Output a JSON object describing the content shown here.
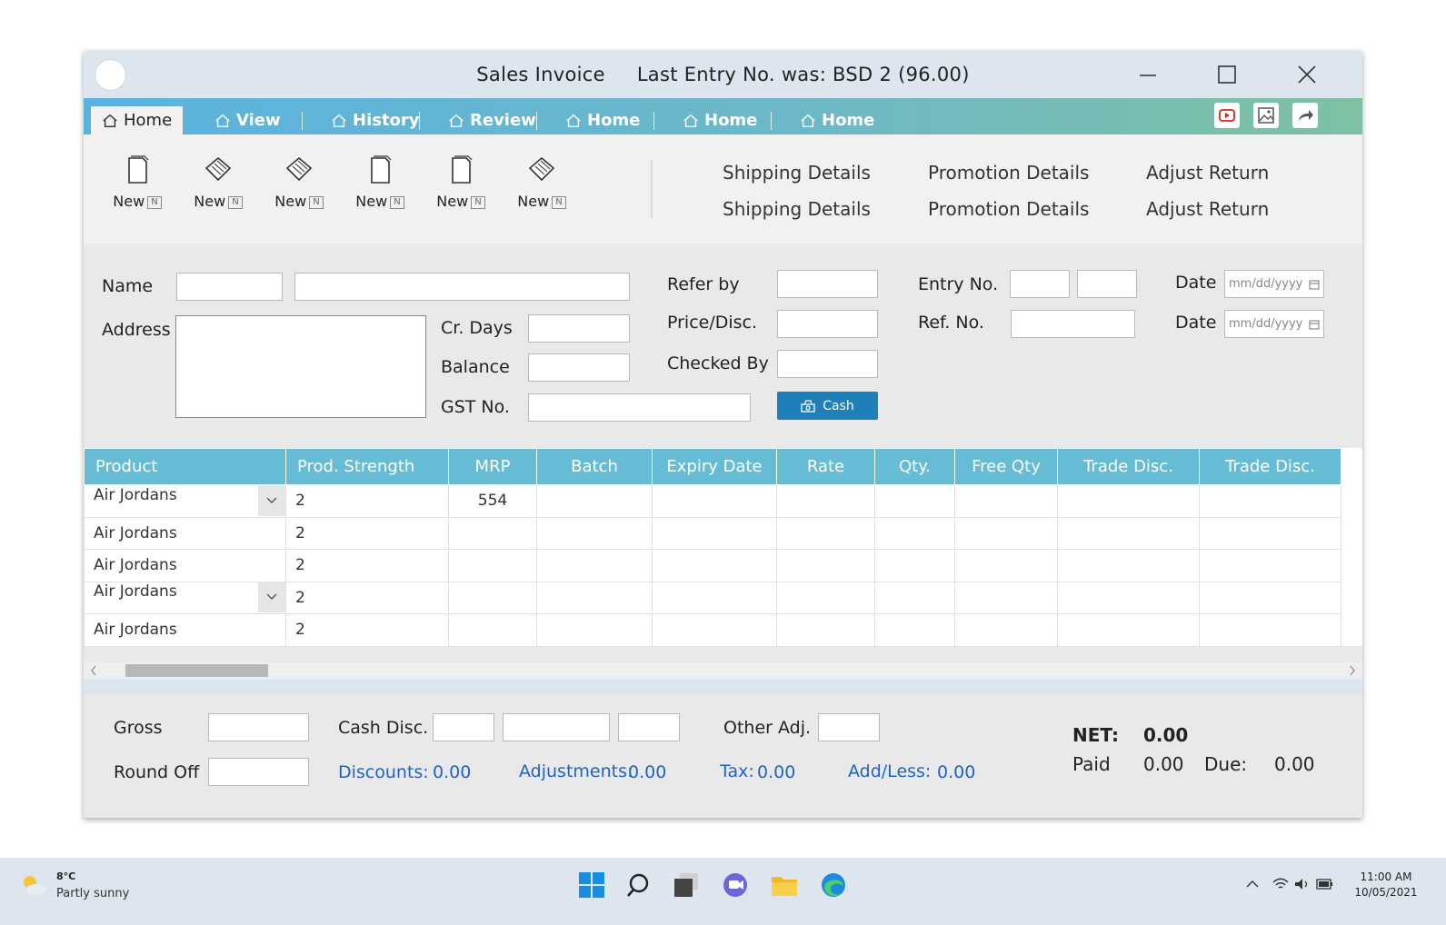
{
  "window": {
    "title": "Sales Invoice",
    "last_entry": "Last Entry No. was:  BSD 2 (96.00)"
  },
  "tabs": [
    {
      "label": "Home",
      "active": true
    },
    {
      "label": "View"
    },
    {
      "label": "History"
    },
    {
      "label": "Review"
    },
    {
      "label": "Home"
    },
    {
      "label": "Home"
    },
    {
      "label": "Home"
    }
  ],
  "toolbar": {
    "items": [
      {
        "label": "New",
        "key": "N",
        "icon": "document-icon"
      },
      {
        "label": "New",
        "key": "N",
        "icon": "cube-icon"
      },
      {
        "label": "New",
        "key": "N",
        "icon": "cube-icon"
      },
      {
        "label": "New",
        "key": "N",
        "icon": "document-icon"
      },
      {
        "label": "New",
        "key": "N",
        "icon": "document-icon"
      },
      {
        "label": "New",
        "key": "N",
        "icon": "cube-icon"
      }
    ],
    "links": [
      "Shipping Details",
      "Shipping Details",
      "Promotion Details",
      "Promotion Details",
      "Adjust Return",
      "Adjust Return"
    ]
  },
  "form": {
    "name_label": "Name",
    "address_label": "Address",
    "cr_days_label": "Cr. Days",
    "balance_label": "Balance",
    "gst_label": "GST No.",
    "refer_by_label": "Refer by",
    "price_disc_label": "Price/Disc.",
    "checked_by_label": "Checked By",
    "cash_button": "Cash",
    "entry_no_label": "Entry No.",
    "ref_no_label": "Ref. No.",
    "date_label": "Date",
    "date_placeholder": "mm/dd/yyyy"
  },
  "grid": {
    "columns": [
      "Product",
      "Prod. Strength",
      "MRP",
      "Batch",
      "Expiry Date",
      "Rate",
      "Qty.",
      "Free Qty",
      "Trade Disc.",
      "Trade Disc."
    ],
    "rows": [
      {
        "product": "Air Jordans",
        "strength": "2",
        "mrp": "554",
        "dropdown": true
      },
      {
        "product": "Air Jordans",
        "strength": "2",
        "mrp": "",
        "dropdown": false
      },
      {
        "product": "Air Jordans",
        "strength": "2",
        "mrp": "",
        "dropdown": false
      },
      {
        "product": "Air Jordans",
        "strength": "2",
        "mrp": "",
        "dropdown": true
      },
      {
        "product": "Air Jordans",
        "strength": "2",
        "mrp": "",
        "dropdown": false
      }
    ]
  },
  "footer": {
    "gross_label": "Gross",
    "round_off_label": "Round Off",
    "cash_disc_label": "Cash Disc.",
    "other_adj_label": "Other Adj.",
    "discounts_label": "Discounts:",
    "discounts_value": "0.00",
    "adjustments_label": "Adjustments:",
    "adjustments_value": "0.00",
    "tax_label": "Tax:",
    "tax_value": "0.00",
    "addless_label": "Add/Less:",
    "addless_value": "0.00",
    "net_label": "NET:",
    "net_value": "0.00",
    "paid_label": "Paid",
    "paid_value": "0.00",
    "due_label": "Due:",
    "due_value": "0.00"
  },
  "taskbar": {
    "temperature": "8°C",
    "weather": "Partly sunny",
    "time": "11:00 AM",
    "date": "10/05/2021"
  },
  "colors": {
    "accent_blue": "#1f7fb8",
    "grid_header": "#67bcd5",
    "link_blue": "#1e63c9"
  }
}
